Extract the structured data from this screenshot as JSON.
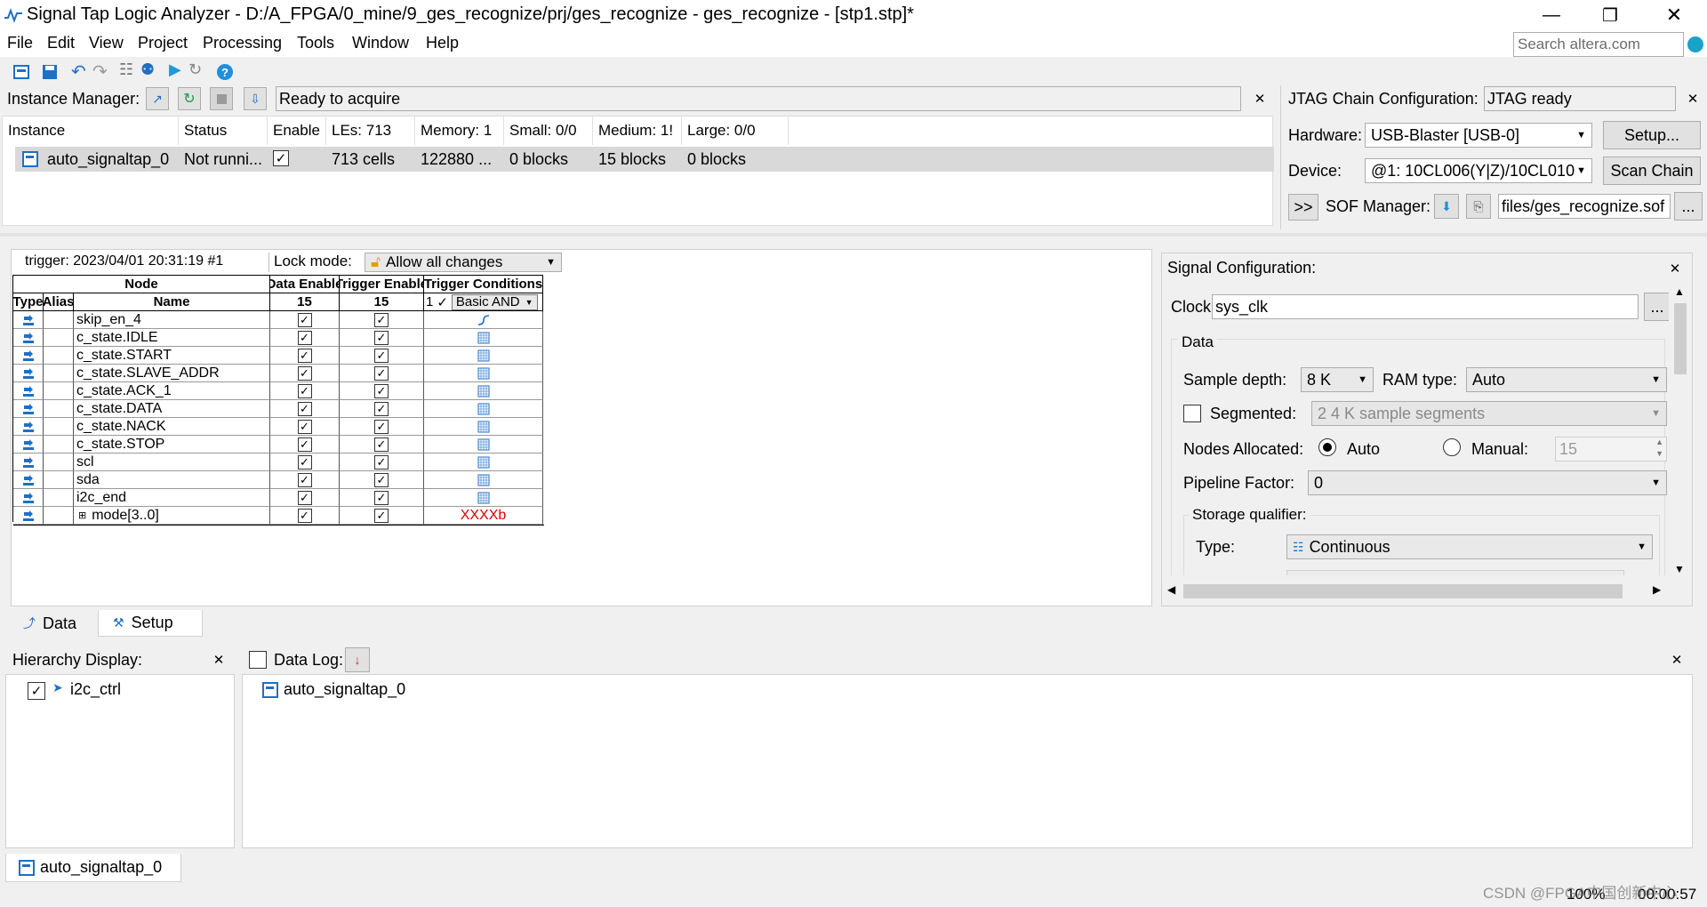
{
  "window": {
    "title": "Signal Tap Logic Analyzer - D:/A_FPGA/0_mine/9_ges_recognize/prj/ges_recognize - ges_recognize - [stp1.stp]*"
  },
  "menu": [
    "File",
    "Edit",
    "View",
    "Project",
    "Processing",
    "Tools",
    "Window",
    "Help"
  ],
  "search": {
    "placeholder": "Search altera.com"
  },
  "instance_manager": {
    "label": "Instance Manager:",
    "status": "Ready to acquire",
    "columns": [
      "Instance",
      "Status",
      "Enable",
      "LEs: 713",
      "Memory: 1",
      "Small: 0/0",
      "Medium: 1!",
      "Large: 0/0"
    ],
    "row": {
      "instance": "auto_signaltap_0",
      "status": "Not runni...",
      "enabled": "✓",
      "les": "713 cells",
      "memory": "122880 ...",
      "small": "0 blocks",
      "medium": "15 blocks",
      "large": "0 blocks"
    }
  },
  "jtag": {
    "label": "JTAG Chain Configuration:",
    "status": "JTAG ready",
    "hardware_label": "Hardware:",
    "hardware_value": "USB-Blaster [USB-0]",
    "setup_button": "Setup...",
    "device_label": "Device:",
    "device_value": "@1: 10CL006(Y|Z)/10CL010",
    "scan_chain_button": "Scan Chain",
    "expand_button": ">>",
    "sof_label": "SOF Manager:",
    "sof_value": "files/ges_recognize.sof",
    "browse_button": "..."
  },
  "trigger_bar": {
    "trigger_info": "trigger: 2023/04/01 20:31:19  #1",
    "lock_label": "Lock mode:",
    "lock_value": "Allow all changes"
  },
  "node_table": {
    "group_headers": [
      "Node",
      "Data Enable",
      "Trigger Enable",
      "Trigger Conditions"
    ],
    "sub_headers": [
      "Type",
      "Alias",
      "Name",
      "15",
      "15",
      "1",
      "Basic AND"
    ],
    "rows": [
      {
        "name": "skip_en_4",
        "data": "✓",
        "trig": "✓",
        "cond": "rising"
      },
      {
        "name": "c_state.IDLE",
        "data": "✓",
        "trig": "✓",
        "cond": "dontcare"
      },
      {
        "name": "c_state.START",
        "data": "✓",
        "trig": "✓",
        "cond": "dontcare"
      },
      {
        "name": "c_state.SLAVE_ADDR",
        "data": "✓",
        "trig": "✓",
        "cond": "dontcare"
      },
      {
        "name": "c_state.ACK_1",
        "data": "✓",
        "trig": "✓",
        "cond": "dontcare"
      },
      {
        "name": "c_state.DATA",
        "data": "✓",
        "trig": "✓",
        "cond": "dontcare"
      },
      {
        "name": "c_state.NACK",
        "data": "✓",
        "trig": "✓",
        "cond": "dontcare"
      },
      {
        "name": "c_state.STOP",
        "data": "✓",
        "trig": "✓",
        "cond": "dontcare"
      },
      {
        "name": "scl",
        "data": "✓",
        "trig": "✓",
        "cond": "dontcare"
      },
      {
        "name": "sda",
        "data": "✓",
        "trig": "✓",
        "cond": "dontcare"
      },
      {
        "name": "i2c_end",
        "data": "✓",
        "trig": "✓",
        "cond": "dontcare"
      },
      {
        "name": "mode[3..0]",
        "data": "✓",
        "trig": "✓",
        "cond": "XXXXb",
        "expandable": "⊞"
      }
    ]
  },
  "tabs": {
    "data": "Data",
    "setup": "Setup"
  },
  "signal_config": {
    "title": "Signal Configuration:",
    "clock_label": "Clock:",
    "clock_value": "sys_clk",
    "clock_browse": "...",
    "data_group": "Data",
    "sample_depth_label": "Sample depth:",
    "sample_depth_value": "8 K",
    "ram_type_label": "RAM type:",
    "ram_type_value": "Auto",
    "segmented_label": "Segmented:",
    "segmented_value": "2  4 K sample segments",
    "nodes_allocated_label": "Nodes Allocated:",
    "auto_label": "Auto",
    "manual_label": "Manual:",
    "manual_value": "15",
    "pipeline_label": "Pipeline Factor:",
    "pipeline_value": "0",
    "storage_label": "Storage qualifier:",
    "type_label": "Type:",
    "type_value": "Continuous"
  },
  "hierarchy": {
    "title": "Hierarchy Display:",
    "item": "i2c_ctrl",
    "checked": "✓"
  },
  "data_log": {
    "title": "Data Log:",
    "item": "auto_signaltap_0"
  },
  "status_bar": {
    "instance_tab": "auto_signaltap_0",
    "zoom": "100%",
    "time": "00:00:57",
    "watermark": "CSDN @FPGA中国创新中心"
  },
  "colors": {
    "accent_blue": "#1f6fc5",
    "trigger_red": "#e00000",
    "selection": "#d9d9d9"
  }
}
